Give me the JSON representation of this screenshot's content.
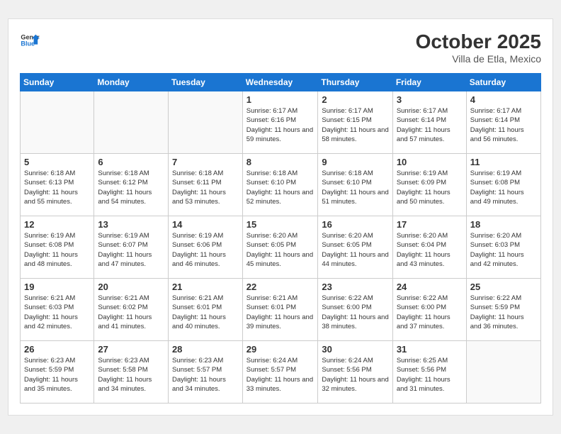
{
  "header": {
    "logo_line1": "General",
    "logo_line2": "Blue",
    "month_title": "October 2025",
    "location": "Villa de Etla, Mexico"
  },
  "days_of_week": [
    "Sunday",
    "Monday",
    "Tuesday",
    "Wednesday",
    "Thursday",
    "Friday",
    "Saturday"
  ],
  "weeks": [
    [
      {
        "day": "",
        "info": ""
      },
      {
        "day": "",
        "info": ""
      },
      {
        "day": "",
        "info": ""
      },
      {
        "day": "1",
        "info": "Sunrise: 6:17 AM\nSunset: 6:16 PM\nDaylight: 11 hours\nand 59 minutes."
      },
      {
        "day": "2",
        "info": "Sunrise: 6:17 AM\nSunset: 6:15 PM\nDaylight: 11 hours\nand 58 minutes."
      },
      {
        "day": "3",
        "info": "Sunrise: 6:17 AM\nSunset: 6:14 PM\nDaylight: 11 hours\nand 57 minutes."
      },
      {
        "day": "4",
        "info": "Sunrise: 6:17 AM\nSunset: 6:14 PM\nDaylight: 11 hours\nand 56 minutes."
      }
    ],
    [
      {
        "day": "5",
        "info": "Sunrise: 6:18 AM\nSunset: 6:13 PM\nDaylight: 11 hours\nand 55 minutes."
      },
      {
        "day": "6",
        "info": "Sunrise: 6:18 AM\nSunset: 6:12 PM\nDaylight: 11 hours\nand 54 minutes."
      },
      {
        "day": "7",
        "info": "Sunrise: 6:18 AM\nSunset: 6:11 PM\nDaylight: 11 hours\nand 53 minutes."
      },
      {
        "day": "8",
        "info": "Sunrise: 6:18 AM\nSunset: 6:10 PM\nDaylight: 11 hours\nand 52 minutes."
      },
      {
        "day": "9",
        "info": "Sunrise: 6:18 AM\nSunset: 6:10 PM\nDaylight: 11 hours\nand 51 minutes."
      },
      {
        "day": "10",
        "info": "Sunrise: 6:19 AM\nSunset: 6:09 PM\nDaylight: 11 hours\nand 50 minutes."
      },
      {
        "day": "11",
        "info": "Sunrise: 6:19 AM\nSunset: 6:08 PM\nDaylight: 11 hours\nand 49 minutes."
      }
    ],
    [
      {
        "day": "12",
        "info": "Sunrise: 6:19 AM\nSunset: 6:08 PM\nDaylight: 11 hours\nand 48 minutes."
      },
      {
        "day": "13",
        "info": "Sunrise: 6:19 AM\nSunset: 6:07 PM\nDaylight: 11 hours\nand 47 minutes."
      },
      {
        "day": "14",
        "info": "Sunrise: 6:19 AM\nSunset: 6:06 PM\nDaylight: 11 hours\nand 46 minutes."
      },
      {
        "day": "15",
        "info": "Sunrise: 6:20 AM\nSunset: 6:05 PM\nDaylight: 11 hours\nand 45 minutes."
      },
      {
        "day": "16",
        "info": "Sunrise: 6:20 AM\nSunset: 6:05 PM\nDaylight: 11 hours\nand 44 minutes."
      },
      {
        "day": "17",
        "info": "Sunrise: 6:20 AM\nSunset: 6:04 PM\nDaylight: 11 hours\nand 43 minutes."
      },
      {
        "day": "18",
        "info": "Sunrise: 6:20 AM\nSunset: 6:03 PM\nDaylight: 11 hours\nand 42 minutes."
      }
    ],
    [
      {
        "day": "19",
        "info": "Sunrise: 6:21 AM\nSunset: 6:03 PM\nDaylight: 11 hours\nand 42 minutes."
      },
      {
        "day": "20",
        "info": "Sunrise: 6:21 AM\nSunset: 6:02 PM\nDaylight: 11 hours\nand 41 minutes."
      },
      {
        "day": "21",
        "info": "Sunrise: 6:21 AM\nSunset: 6:01 PM\nDaylight: 11 hours\nand 40 minutes."
      },
      {
        "day": "22",
        "info": "Sunrise: 6:21 AM\nSunset: 6:01 PM\nDaylight: 11 hours\nand 39 minutes."
      },
      {
        "day": "23",
        "info": "Sunrise: 6:22 AM\nSunset: 6:00 PM\nDaylight: 11 hours\nand 38 minutes."
      },
      {
        "day": "24",
        "info": "Sunrise: 6:22 AM\nSunset: 6:00 PM\nDaylight: 11 hours\nand 37 minutes."
      },
      {
        "day": "25",
        "info": "Sunrise: 6:22 AM\nSunset: 5:59 PM\nDaylight: 11 hours\nand 36 minutes."
      }
    ],
    [
      {
        "day": "26",
        "info": "Sunrise: 6:23 AM\nSunset: 5:59 PM\nDaylight: 11 hours\nand 35 minutes."
      },
      {
        "day": "27",
        "info": "Sunrise: 6:23 AM\nSunset: 5:58 PM\nDaylight: 11 hours\nand 34 minutes."
      },
      {
        "day": "28",
        "info": "Sunrise: 6:23 AM\nSunset: 5:57 PM\nDaylight: 11 hours\nand 34 minutes."
      },
      {
        "day": "29",
        "info": "Sunrise: 6:24 AM\nSunset: 5:57 PM\nDaylight: 11 hours\nand 33 minutes."
      },
      {
        "day": "30",
        "info": "Sunrise: 6:24 AM\nSunset: 5:56 PM\nDaylight: 11 hours\nand 32 minutes."
      },
      {
        "day": "31",
        "info": "Sunrise: 6:25 AM\nSunset: 5:56 PM\nDaylight: 11 hours\nand 31 minutes."
      },
      {
        "day": "",
        "info": ""
      }
    ]
  ]
}
